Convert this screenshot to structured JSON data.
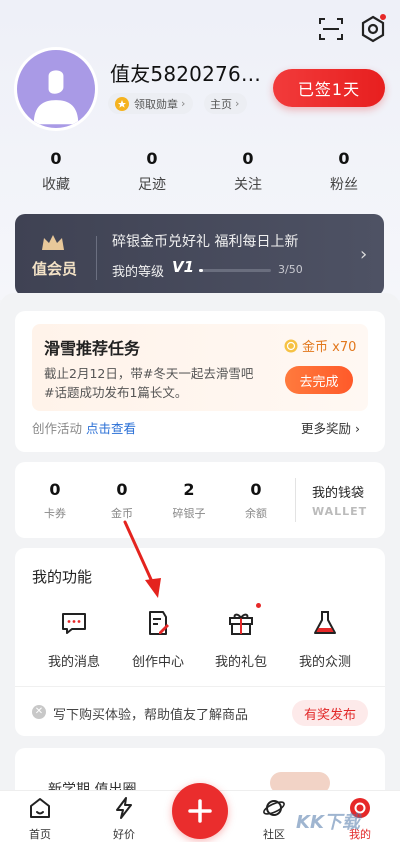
{
  "profile": {
    "username": "值友5820276…",
    "badge_chip": "领取勋章",
    "home_chip": "主页",
    "signin_label": "已签1天"
  },
  "stats": [
    {
      "value": "0",
      "label": "收藏"
    },
    {
      "value": "0",
      "label": "足迹"
    },
    {
      "value": "0",
      "label": "关注"
    },
    {
      "value": "0",
      "label": "粉丝"
    }
  ],
  "vip": {
    "label": "值会员",
    "title": "碎银金币兑好礼 福利每日上新",
    "level_label": "我的等级",
    "level": "V1",
    "progress_text": "3/50",
    "progress_fraction": 0.06
  },
  "task": {
    "title": "滑雪推荐任务",
    "reward": "金币 x70",
    "desc_line1": "截止2月12日，带#冬天一起去滑雪吧",
    "desc_line2": "#话题成功发布1篇长文。",
    "button": "去完成",
    "footer_prefix": "创作活动",
    "footer_link": "点击查看",
    "more_rewards": "更多奖励 ›"
  },
  "wallet": {
    "items": [
      {
        "value": "0",
        "label": "卡券"
      },
      {
        "value": "0",
        "label": "金币"
      },
      {
        "value": "2",
        "label": "碎银子"
      },
      {
        "value": "0",
        "label": "余额"
      }
    ],
    "title": "我的钱袋",
    "subtitle": "WALLET"
  },
  "functions": {
    "title": "我的功能",
    "items": [
      {
        "label": "我的消息",
        "icon": "message-icon"
      },
      {
        "label": "创作中心",
        "icon": "edit-icon"
      },
      {
        "label": "我的礼包",
        "icon": "gift-icon"
      },
      {
        "label": "我的众测",
        "icon": "flask-icon"
      }
    ],
    "notice": "写下购买体验，帮助值友了解商品",
    "notice_button": "有奖发布"
  },
  "promo": {
    "text": "新学期 值出圈"
  },
  "bottom_nav": [
    {
      "label": "首页",
      "icon": "home-icon"
    },
    {
      "label": "好价",
      "icon": "lightning-icon"
    },
    {
      "label": "",
      "icon": "plus-icon"
    },
    {
      "label": "社区",
      "icon": "planet-icon"
    },
    {
      "label": "我的",
      "icon": "profile-icon"
    }
  ],
  "watermark": "KK下载",
  "colors": {
    "accent": "#e62828",
    "vip_bg": "#444757",
    "link": "#2a6fd6",
    "coin": "#e2781d"
  }
}
